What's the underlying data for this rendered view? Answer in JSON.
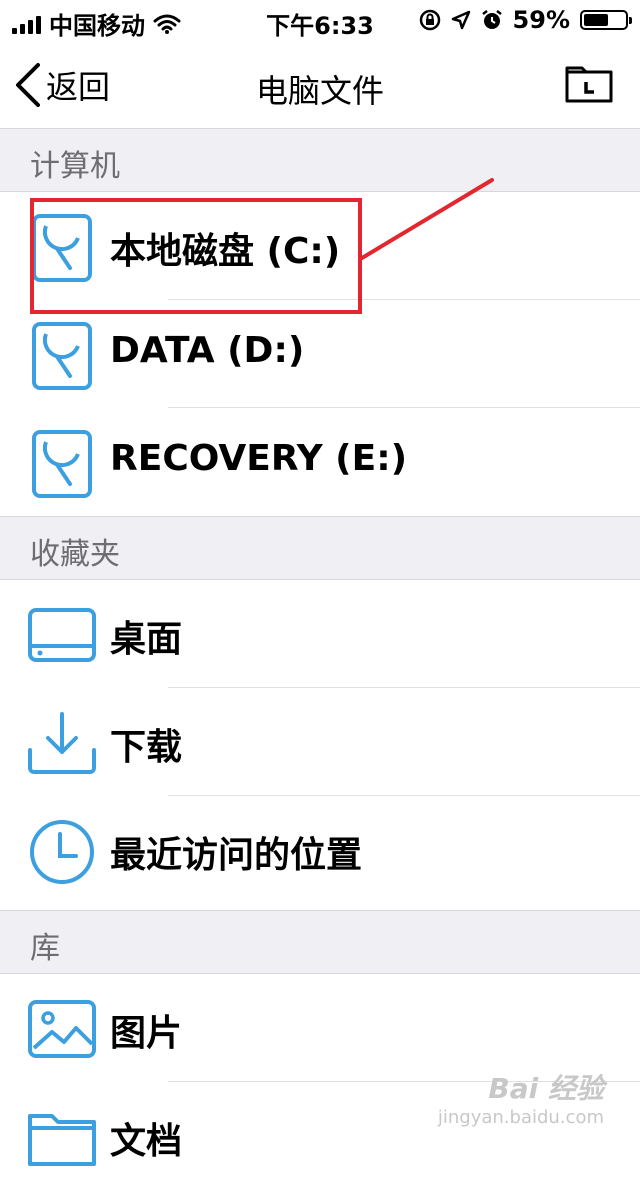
{
  "status_bar": {
    "carrier": "中国移动",
    "time": "下午6:33",
    "battery_percent": "59%",
    "battery_level": 0.59
  },
  "nav": {
    "back_label": "返回",
    "title": "电脑文件"
  },
  "sections": {
    "computer": {
      "header": "计算机",
      "items": [
        {
          "label": "本地磁盘 (C:)"
        },
        {
          "label": "DATA (D:)"
        },
        {
          "label": "RECOVERY (E:)"
        }
      ]
    },
    "favorites": {
      "header": "收藏夹",
      "items": [
        {
          "label": "桌面"
        },
        {
          "label": "下载"
        },
        {
          "label": "最近访问的位置"
        }
      ]
    },
    "library": {
      "header": "库",
      "items": [
        {
          "label": "图片"
        },
        {
          "label": "文档"
        }
      ]
    }
  },
  "colors": {
    "accent": "#3ca0e0",
    "highlight": "#e3262f",
    "section_bg": "#efeff4"
  },
  "icons": [
    "back-chevron-icon",
    "folder-icon",
    "disk-icon",
    "desktop-icon",
    "download-icon",
    "clock-icon",
    "image-icon",
    "folder-icon"
  ],
  "watermark": {
    "brand": "Bai 经验",
    "url": "jingyan.baidu.com"
  }
}
